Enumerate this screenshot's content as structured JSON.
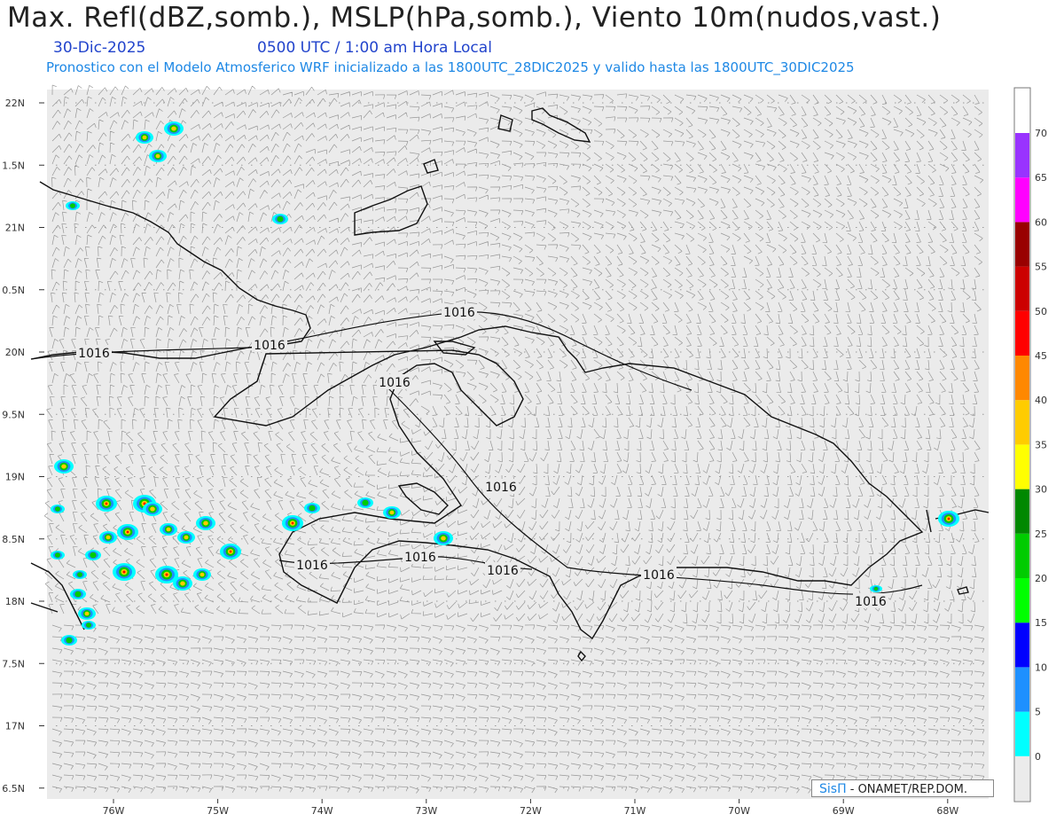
{
  "header": {
    "title": "Max. Refl(dBZ,somb.), MSLP(hPa,somb.), Viento 10m(nudos,vast.)",
    "date": "30-Dic-2025",
    "time": "0500 UTC / 1:00 am Hora Local",
    "forecast_info": "Pronostico con el Modelo Atmosferico WRF inicializado a las 1800UTC_28DIC2025 y valido hasta las  1800UTC_30DIC2025"
  },
  "map": {
    "lat_labels": [
      "22N",
      "1.5N",
      "21N",
      "0.5N",
      "20N",
      "9.5N",
      "19N",
      "8.5N",
      "18N",
      "7.5N",
      "17N",
      "6.5N"
    ],
    "lon_labels": [
      "76W",
      "75W",
      "74W",
      "73W",
      "72W",
      "71W",
      "70W",
      "69W",
      "68W"
    ],
    "isobar_labels": [
      "1016",
      "1016",
      "1016",
      "1016",
      "1016",
      "1016",
      "1016",
      "1016",
      "1016",
      "1016"
    ],
    "background_color": "#ebebeb",
    "land_outline_color": "#111111",
    "wind_barb_color": "#888888"
  },
  "colorbar": {
    "labels": [
      "70",
      "65",
      "60",
      "55",
      "50",
      "45",
      "40",
      "35",
      "30",
      "25",
      "20",
      "15",
      "10",
      "5",
      "0"
    ],
    "colors": [
      "#ebebeb",
      "#00ffff",
      "#1e90ff",
      "#0000ff",
      "#00ff00",
      "#00cc00",
      "#008800",
      "#ffff00",
      "#ffcc00",
      "#ff8800",
      "#ff0000",
      "#cc0000",
      "#990000",
      "#ff00ff",
      "#9933ff"
    ]
  },
  "credit": {
    "brand": "SisΠ",
    "text": "- ONAMET/REP.DOM."
  }
}
